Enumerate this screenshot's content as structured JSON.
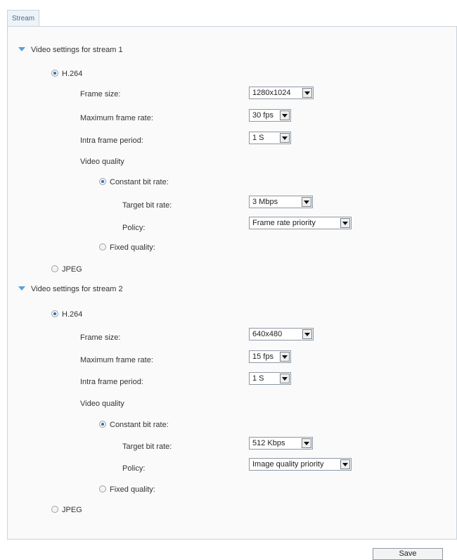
{
  "tab": {
    "label": "Stream"
  },
  "streams": [
    {
      "title": "Video settings for stream 1",
      "h264_label": "H.264",
      "frame_size_label": "Frame size:",
      "frame_size_value": "1280x1024",
      "max_frame_rate_label": "Maximum frame rate:",
      "max_frame_rate_value": "30 fps",
      "intra_frame_label": "Intra frame period:",
      "intra_frame_value": "1 S",
      "video_quality_label": "Video quality",
      "cbr_label": "Constant bit rate:",
      "target_bit_rate_label": "Target bit rate:",
      "target_bit_rate_value": "3 Mbps",
      "policy_label": "Policy:",
      "policy_value": "Frame rate priority",
      "fixed_quality_label": "Fixed quality:",
      "jpeg_label": "JPEG"
    },
    {
      "title": "Video settings for stream 2",
      "h264_label": "H.264",
      "frame_size_label": "Frame size:",
      "frame_size_value": "640x480",
      "max_frame_rate_label": "Maximum frame rate:",
      "max_frame_rate_value": "15 fps",
      "intra_frame_label": "Intra frame period:",
      "intra_frame_value": "1 S",
      "video_quality_label": "Video quality",
      "cbr_label": "Constant bit rate:",
      "target_bit_rate_label": "Target bit rate:",
      "target_bit_rate_value": "512 Kbps",
      "policy_label": "Policy:",
      "policy_value": "Image quality priority",
      "fixed_quality_label": "Fixed quality:",
      "jpeg_label": "JPEG"
    }
  ],
  "save_label": "Save",
  "colors": {
    "accent": "#5b9fd6",
    "tab_text": "#4a6d96",
    "border": "#c9d2dc"
  },
  "icons": {
    "expand": "triangle-down-icon",
    "radio_selected": "radio-selected-icon",
    "radio_unselected": "radio-unselected-icon",
    "dropdown": "chevron-down-icon"
  }
}
